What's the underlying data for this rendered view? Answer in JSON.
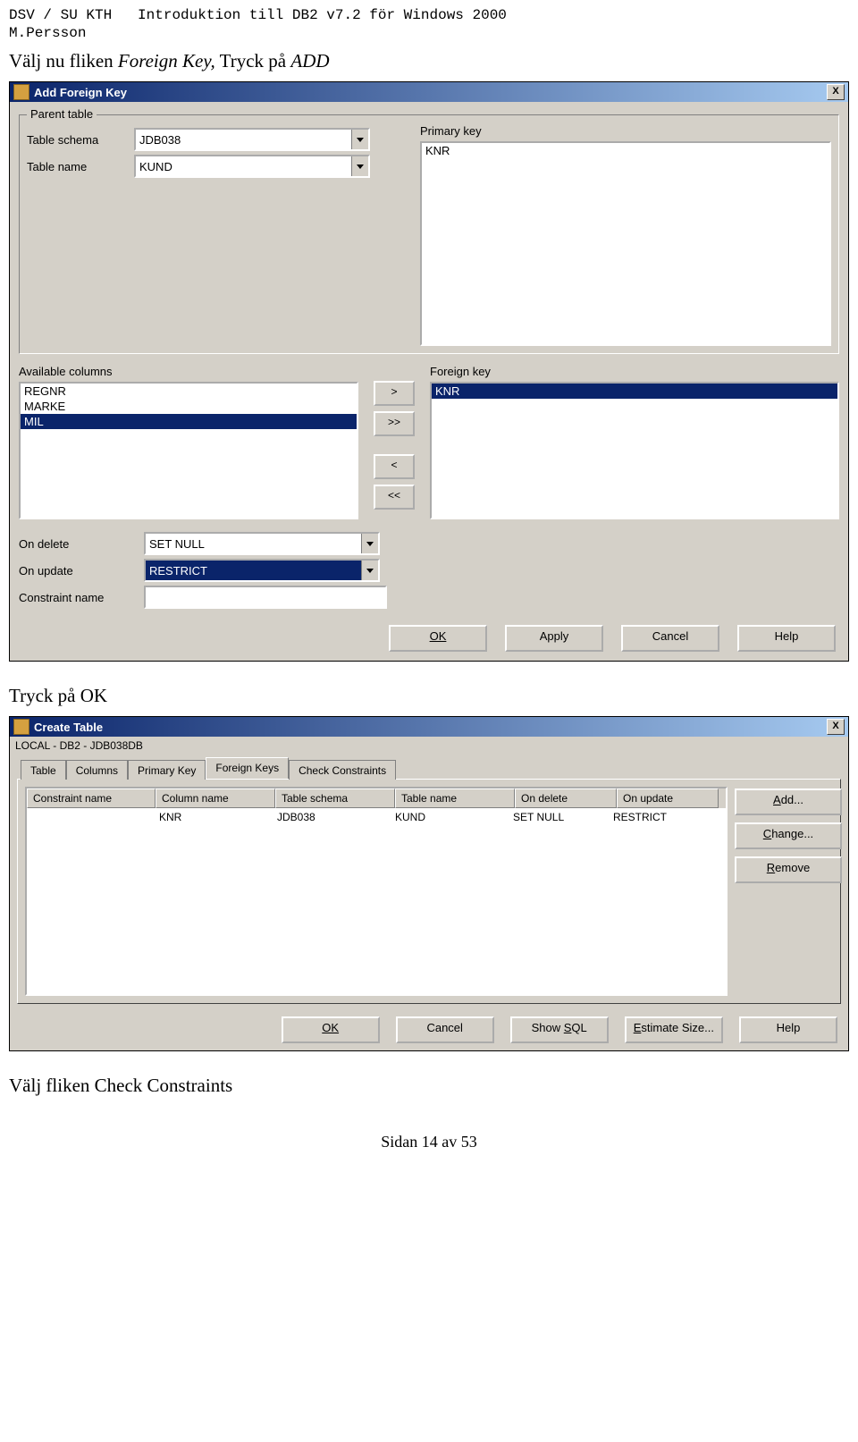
{
  "header": {
    "left": "DSV / SU KTH",
    "right": "Introduktion till DB2 v7.2 för Windows 2000",
    "author": "M.Persson"
  },
  "instruction1_a": "Välj nu fliken ",
  "instruction1_b": "Foreign Key,",
  "instruction1_c": " Tryck på ",
  "instruction1_d": "ADD",
  "dlg1": {
    "title": "Add Foreign Key",
    "close": "X",
    "group": "Parent table",
    "table_schema_label": "Table schema",
    "table_schema_value": "JDB038",
    "table_name_label": "Table name",
    "table_name_value": "KUND",
    "primary_key_label": "Primary key",
    "primary_key_items": [
      "KNR"
    ],
    "available_label": "Available columns",
    "available_items": [
      "REGNR",
      "MARKE",
      "MIL"
    ],
    "available_selected": "MIL",
    "mover": {
      "r": ">",
      "rr": ">>",
      "l": "<",
      "ll": "<<"
    },
    "foreign_key_label": "Foreign key",
    "foreign_key_items": [
      "KNR"
    ],
    "foreign_key_selected": "KNR",
    "on_delete_label": "On delete",
    "on_delete_value": "SET NULL",
    "on_update_label": "On update",
    "on_update_value": "RESTRICT",
    "constraint_label": "Constraint name",
    "constraint_value": "",
    "buttons": {
      "ok": "OK",
      "apply": "Apply",
      "cancel": "Cancel",
      "help": "Help"
    }
  },
  "instruction2": "Tryck på OK",
  "dlg2": {
    "title": "Create Table",
    "close": "X",
    "breadcrumb": "LOCAL - DB2 - JDB038DB",
    "tabs": [
      "Table",
      "Columns",
      "Primary Key",
      "Foreign Keys",
      "Check Constraints"
    ],
    "active_tab": 3,
    "columns": [
      "Constraint name",
      "Column name",
      "Table schema",
      "Table name",
      "On delete",
      "On update"
    ],
    "row": {
      "constraint": "",
      "colname": "KNR",
      "schema": "JDB038",
      "tname": "KUND",
      "ondel": "SET NULL",
      "onupd": "RESTRICT"
    },
    "side": {
      "add": "Add...",
      "change": "Change...",
      "remove": "Remove"
    },
    "bottom": {
      "ok": "OK",
      "cancel": "Cancel",
      "showsql": "Show SQL",
      "estimate": "Estimate Size...",
      "help": "Help"
    }
  },
  "instruction3": "Välj fliken Check Constraints",
  "footer": "Sidan 14 av 53"
}
